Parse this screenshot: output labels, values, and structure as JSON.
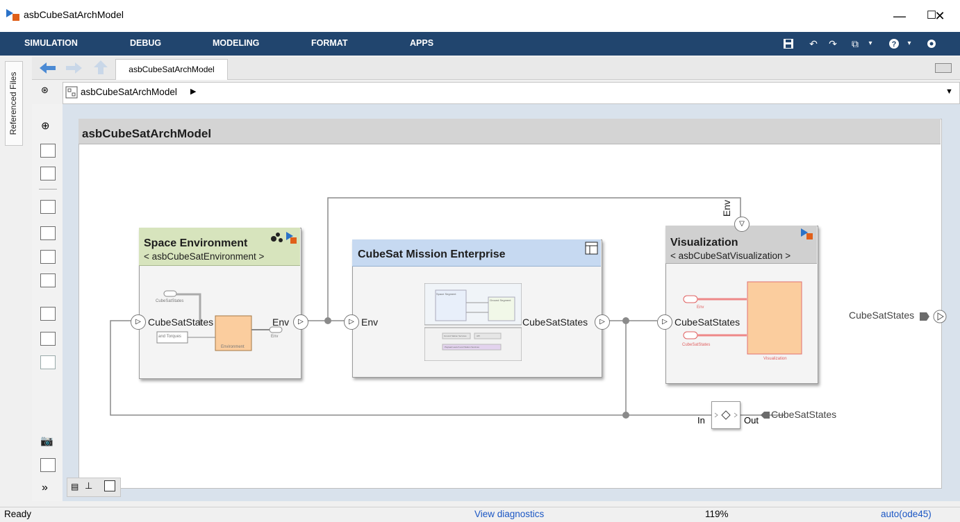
{
  "window": {
    "title": "asbCubeSatArchModel",
    "minimize": "—",
    "maximize": "☐",
    "close": "✕"
  },
  "toolstrip": {
    "tabs": [
      "SIMULATION",
      "DEBUG",
      "MODELING",
      "FORMAT",
      "APPS"
    ],
    "color": "#21456e"
  },
  "side": {
    "referenced_files": "Referenced Files"
  },
  "nav": {
    "tab_label": "asbCubeSatArchModel",
    "breadcrumb": "asbCubeSatArchModel"
  },
  "canvas": {
    "title": "asbCubeSatArchModel",
    "components": {
      "space_env": {
        "title": "Space Environment",
        "ref": "< asbCubeSatEnvironment >",
        "in_port": "CubeSatStates",
        "out_port": "Env",
        "thumb": {
          "in_label": "CubeSatStates",
          "sub_label": "and Torques",
          "block": "Environment",
          "out": "Env"
        },
        "color": "#d7e4bd"
      },
      "mission": {
        "title": "CubeSat Mission Enterprise",
        "in_port": "Env",
        "out_port": "CubeSatStates",
        "thumb": {
          "a": "Space Segment",
          "b": "Ground Segment",
          "c": "Ground Station Services",
          "d": "API",
          "e": "Payload Launch and Station Services"
        },
        "color": "#c6d9f1"
      },
      "visual": {
        "title": "Visualization",
        "ref": "< asbCubeSatVisualization >",
        "in_port_top": "Env",
        "in_port": "CubeSatStates",
        "thumb": {
          "env": "Env",
          "states": "CubeSatStates",
          "block": "Visualization"
        },
        "color": "#d0d0d0"
      }
    },
    "outport_label": "CubeSatStates",
    "adapter": {
      "in": "In",
      "out": "Out",
      "label": "CubeSatStates"
    }
  },
  "status": {
    "left": "Ready",
    "diagnostics": "View diagnostics",
    "zoom": "119%",
    "solver": "auto(ode45)"
  }
}
